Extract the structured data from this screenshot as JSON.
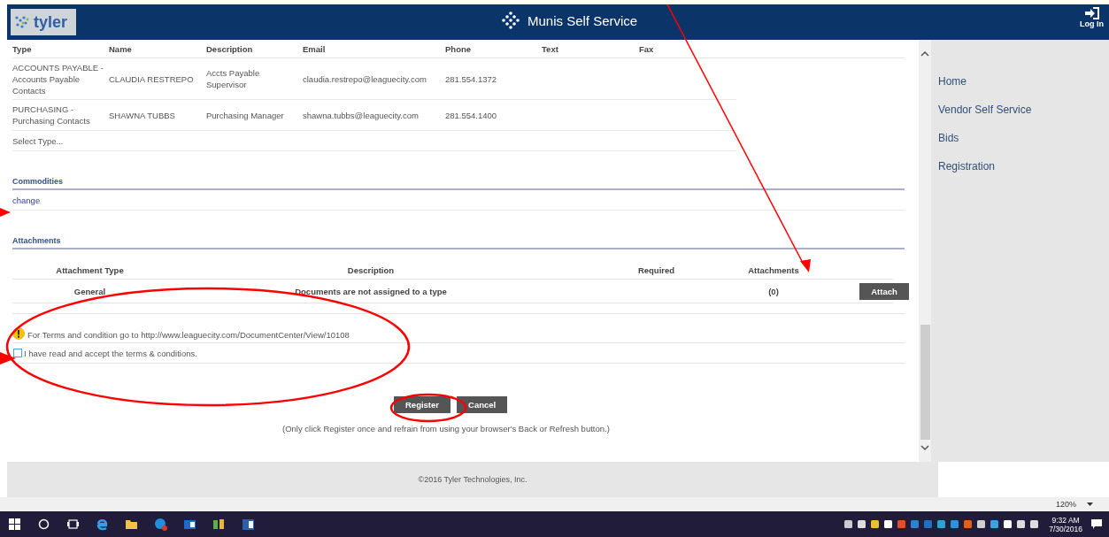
{
  "header": {
    "logo_text": "tyler",
    "title": "Munis Self Service",
    "login": "Log In"
  },
  "contacts": {
    "columns": [
      "Type",
      "Name",
      "Description",
      "Email",
      "Phone",
      "Text",
      "Fax"
    ],
    "rows": [
      [
        "ACCOUNTS PAYABLE - Accounts Payable Contacts",
        "CLAUDIA RESTREPO",
        "Accts Payable Supervisor",
        "claudia.restrepo@leaguecity.com",
        "281.554.1372"
      ],
      [
        "PURCHASING - Purchasing Contacts",
        "SHAWNA TUBBS",
        "Purchasing Manager",
        "shawna.tubbs@leaguecity.com",
        "281.554.1400"
      ]
    ],
    "add_row": "Select Type..."
  },
  "commodities": {
    "title": "Commodities",
    "link": "change"
  },
  "attachments": {
    "title": "Attachments",
    "columns": [
      "Attachment Type",
      "Description",
      "Required",
      "Attachments"
    ],
    "rows": [
      {
        "type": "General",
        "description": "Documents are not assigned to a type",
        "count": "(0)",
        "button": "Attach"
      }
    ]
  },
  "terms": {
    "notice": "For Terms and condition go to http://www.leaguecity.com/DocumentCenter/View/10108",
    "accept_label": "I have read and accept the terms & conditions.",
    "checked": false
  },
  "buttons": [
    "Register",
    "Cancel"
  ],
  "note": "(Only click Register once and refrain from using your browser's Back or Refresh button.)",
  "sidebar": {
    "items": [
      "Home",
      "Vendor Self Service",
      "Bids",
      "Registration"
    ]
  },
  "footer": "©2016 Tyler Technologies, Inc.",
  "zoom": "120%",
  "taskbar": {
    "time": "9:32 AM",
    "date": "7/30/2016"
  }
}
